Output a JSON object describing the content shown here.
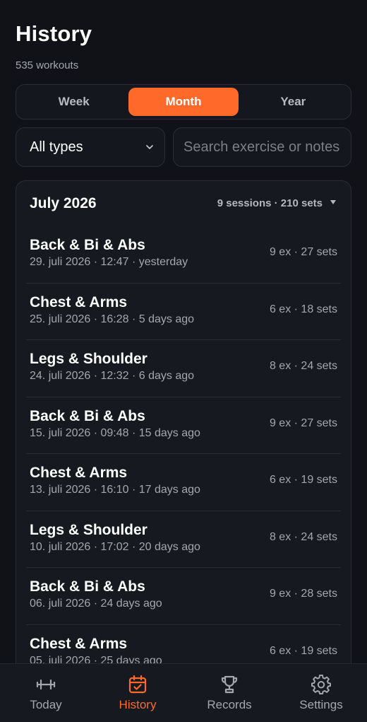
{
  "header": {
    "title": "History",
    "subtitle": "535 workouts"
  },
  "period_tabs": [
    {
      "label": "Week",
      "active": false
    },
    {
      "label": "Month",
      "active": true
    },
    {
      "label": "Year",
      "active": false
    }
  ],
  "filters": {
    "type_selected": "All types",
    "search_placeholder": "Search exercise or notes"
  },
  "month_group": {
    "title": "July 2026",
    "stats": "9 sessions · 210 sets",
    "sessions": [
      {
        "name": "Back & Bi & Abs",
        "meta": "29. juli 2026 · 12:47 · yesterday",
        "count": "9 ex · 27 sets"
      },
      {
        "name": "Chest & Arms",
        "meta": "25. juli 2026 · 16:28 · 5 days ago",
        "count": "6 ex · 18 sets"
      },
      {
        "name": "Legs & Shoulder",
        "meta": "24. juli 2026 · 12:32 · 6 days ago",
        "count": "8 ex · 24 sets"
      },
      {
        "name": "Back & Bi & Abs",
        "meta": "15. juli 2026 · 09:48 · 15 days ago",
        "count": "9 ex · 27 sets"
      },
      {
        "name": "Chest & Arms",
        "meta": "13. juli 2026 · 16:10 · 17 days ago",
        "count": "6 ex · 19 sets"
      },
      {
        "name": "Legs & Shoulder",
        "meta": "10. juli 2026 · 17:02 · 20 days ago",
        "count": "8 ex · 24 sets"
      },
      {
        "name": "Back & Bi & Abs",
        "meta": "06. juli 2026 · 24 days ago",
        "count": "9 ex · 28 sets"
      },
      {
        "name": "Chest & Arms",
        "meta": "05. juli 2026 · 25 days ago",
        "count": "6 ex · 19 sets"
      }
    ]
  },
  "tabbar": [
    {
      "label": "Today",
      "icon": "dumbbell-icon",
      "active": false
    },
    {
      "label": "History",
      "icon": "calendar-check-icon",
      "active": true
    },
    {
      "label": "Records",
      "icon": "trophy-icon",
      "active": false
    },
    {
      "label": "Settings",
      "icon": "gear-icon",
      "active": false
    }
  ],
  "colors": {
    "accent": "#ff6a2b",
    "background": "#111218",
    "card": "#171920",
    "muted_text": "#a4a7b1"
  }
}
